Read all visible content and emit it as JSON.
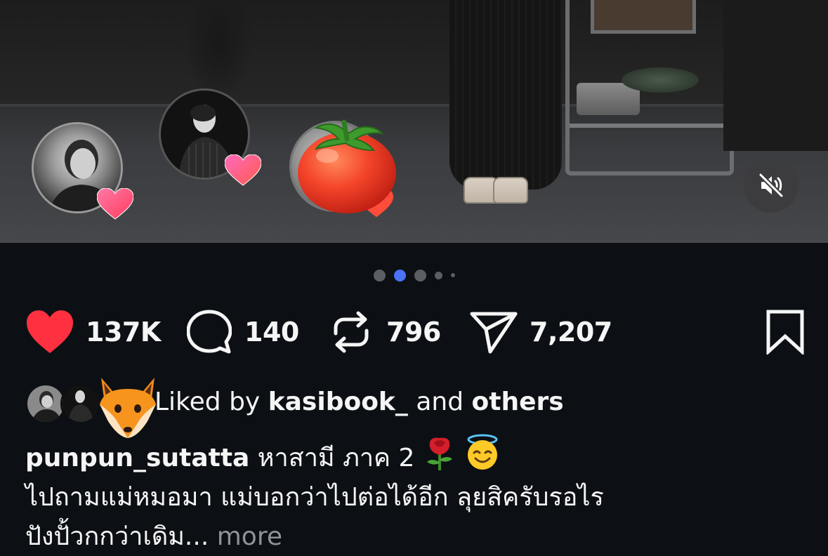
{
  "media": {
    "icons": {
      "mute": "speaker-muted-icon"
    }
  },
  "carousel": {
    "dot_count": 5,
    "active_index": 1,
    "active_color": "#4a73f5"
  },
  "actions": {
    "like": {
      "icon": "heart-icon",
      "count": "137K",
      "liked": true,
      "color": "#ff3040"
    },
    "comment": {
      "icon": "comment-bubble-icon",
      "count": "140"
    },
    "repost": {
      "icon": "repost-icon",
      "count": "796"
    },
    "share": {
      "icon": "paper-plane-icon",
      "count": "7,207"
    },
    "save": {
      "icon": "bookmark-icon"
    }
  },
  "likes": {
    "prefix": "Liked by",
    "user": "kasibook_",
    "middle": "and",
    "suffix": "others"
  },
  "caption": {
    "username": "punpun_sutatta",
    "title": "หาสามี ภาค 2",
    "line2": "ไปถามแม่หมอมา แม่บอกว่าไปต่อได้อีก ลุยสิครับรอไร",
    "line3": "ปังปั้วกกว่าเดิม...",
    "more": "more",
    "emojis": [
      "rose-emoji",
      "smiling-face-with-halo-emoji"
    ]
  }
}
